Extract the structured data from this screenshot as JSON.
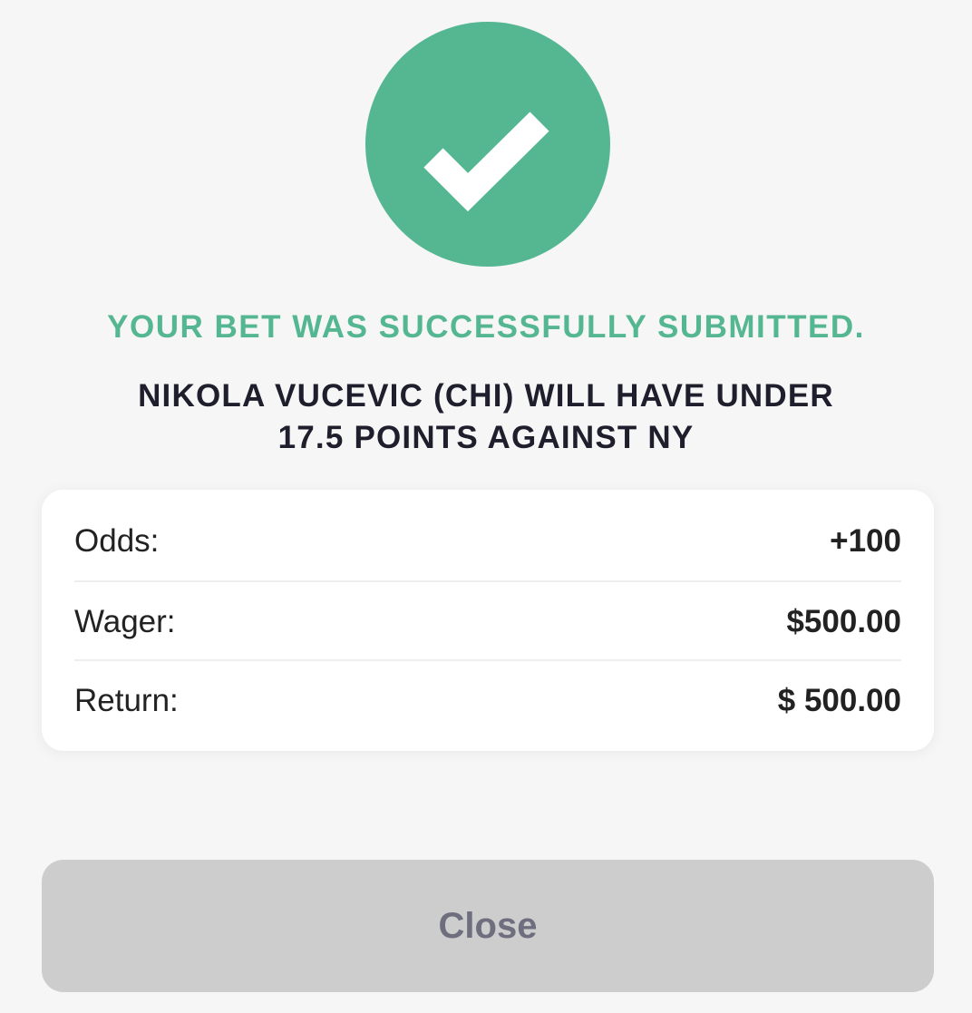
{
  "status": {
    "icon": "checkmark-icon",
    "message": "YOUR BET WAS SUCCESSFULLY SUBMITTED."
  },
  "bet": {
    "line1": "NIKOLA VUCEVIC (CHI) WILL HAVE UNDER",
    "line2": "17.5 POINTS AGAINST NY"
  },
  "summary": {
    "odds_label": "Odds:",
    "odds_value": "+100",
    "wager_label": "Wager:",
    "wager_value": "$500.00",
    "return_label": "Return:",
    "return_value": "$ 500.00"
  },
  "close_button": {
    "label": "Close"
  },
  "colors": {
    "accent": "#54b791",
    "background": "#f6f6f6",
    "button_disabled": "#cdcdcd"
  }
}
